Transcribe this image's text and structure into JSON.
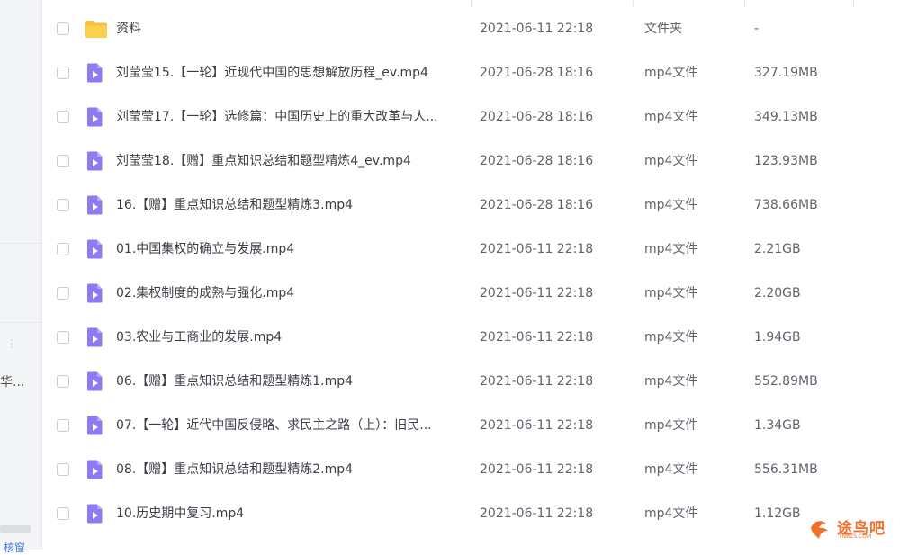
{
  "sidebar": {
    "truncated_item": "华...",
    "bottom_link": "核窗"
  },
  "files": [
    {
      "name": "资料",
      "modified": "2021-06-11 22:18",
      "type": "文件夹",
      "size": "-",
      "icon": "folder-icon"
    },
    {
      "name": "刘莹莹15.【一轮】近现代中国的思想解放历程_ev.mp4",
      "modified": "2021-06-28 18:16",
      "type": "mp4文件",
      "size": "327.19MB",
      "icon": "video-file-icon"
    },
    {
      "name": "刘莹莹17.【一轮】选修篇：中国历史上的重大改革与人...",
      "modified": "2021-06-28 18:16",
      "type": "mp4文件",
      "size": "349.13MB",
      "icon": "video-file-icon"
    },
    {
      "name": "刘莹莹18.【赠】重点知识总结和题型精炼4_ev.mp4",
      "modified": "2021-06-28 18:16",
      "type": "mp4文件",
      "size": "123.93MB",
      "icon": "video-file-icon"
    },
    {
      "name": "16.【赠】重点知识总结和题型精炼3.mp4",
      "modified": "2021-06-28 18:16",
      "type": "mp4文件",
      "size": "738.66MB",
      "icon": "video-file-icon"
    },
    {
      "name": "01.中国集权的确立与发展.mp4",
      "modified": "2021-06-11 22:18",
      "type": "mp4文件",
      "size": "2.21GB",
      "icon": "video-file-icon"
    },
    {
      "name": "02.集权制度的成熟与强化.mp4",
      "modified": "2021-06-11 22:18",
      "type": "mp4文件",
      "size": "2.20GB",
      "icon": "video-file-icon"
    },
    {
      "name": "03.农业与工商业的发展.mp4",
      "modified": "2021-06-11 22:18",
      "type": "mp4文件",
      "size": "1.94GB",
      "icon": "video-file-icon"
    },
    {
      "name": "06.【赠】重点知识总结和题型精炼1.mp4",
      "modified": "2021-06-11 22:18",
      "type": "mp4文件",
      "size": "552.89MB",
      "icon": "video-file-icon"
    },
    {
      "name": "07.【一轮】近代中国反侵略、求民主之路（上）：旧民...",
      "modified": "2021-06-11 22:18",
      "type": "mp4文件",
      "size": "1.34GB",
      "icon": "video-file-icon"
    },
    {
      "name": "08.【赠】重点知识总结和题型精炼2.mp4",
      "modified": "2021-06-11 22:18",
      "type": "mp4文件",
      "size": "556.31MB",
      "icon": "video-file-icon"
    },
    {
      "name": "10.历史期中复习.mp4",
      "modified": "2021-06-11 22:18",
      "type": "mp4文件",
      "size": "1.12GB",
      "icon": "video-file-icon"
    }
  ],
  "watermark": {
    "text": "途鸟吧",
    "sub": "TNBZS.COM"
  },
  "colors": {
    "folder": "#f7c23b",
    "video_icon": "#8c7bf2",
    "accent": "#4a79e8",
    "watermark": "#f0712b"
  }
}
